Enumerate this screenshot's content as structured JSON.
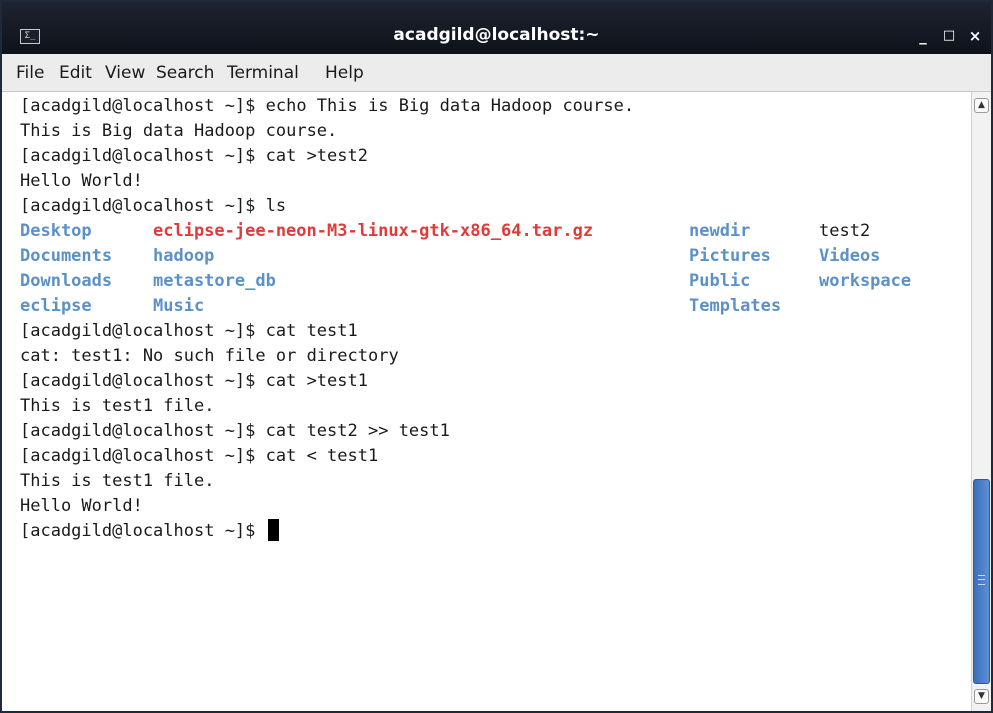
{
  "window": {
    "title": "acadgild@localhost:~",
    "terminal_icon": "terminal-icon",
    "icon_glyph": "Σ_",
    "minimize_glyph": "_",
    "maximize_glyph": "□",
    "close_glyph": "×"
  },
  "menu": {
    "file": "File",
    "edit": "Edit",
    "view": "View",
    "search": "Search",
    "terminal": "Terminal",
    "help": "Help"
  },
  "terminal": {
    "lines": [
      "[acadgild@localhost ~]$ echo This is Big data Hadoop course.",
      "This is Big data Hadoop course.",
      "[acadgild@localhost ~]$ cat >test2",
      "Hello World!",
      "[acadgild@localhost ~]$ ls",
      "[acadgild@localhost ~]$ cat test1",
      "cat: test1: No such file or directory",
      "[acadgild@localhost ~]$ cat >test1",
      "This is test1 file.",
      "[acadgild@localhost ~]$ cat test2 >> test1",
      "[acadgild@localhost ~]$ cat < test1",
      "This is test1 file.",
      "Hello World!",
      "[acadgild@localhost ~]$ "
    ],
    "ls_output": {
      "r1c1": "Desktop",
      "r1c2": "eclipse-jee-neon-M3-linux-gtk-x86_64.tar.gz",
      "r1c3": "newdir",
      "r1c4": "test2",
      "r2c1": "Documents",
      "r2c2": "hadoop",
      "r2c3": "Pictures",
      "r2c4": "Videos",
      "r3c1": "Downloads",
      "r3c2": "metastore_db",
      "r3c3": "Public",
      "r3c4": "workspace",
      "r4c1": "eclipse",
      "r4c2": "Music",
      "r4c3": "Templates"
    },
    "colors": {
      "directory": "#5b91c8",
      "archive": "#e03a3a",
      "text": "#1a1a1a",
      "background": "#ffffff"
    }
  },
  "scrollbar": {
    "up_glyph": "▲",
    "down_glyph": "▼",
    "position_fraction": 0.75
  }
}
